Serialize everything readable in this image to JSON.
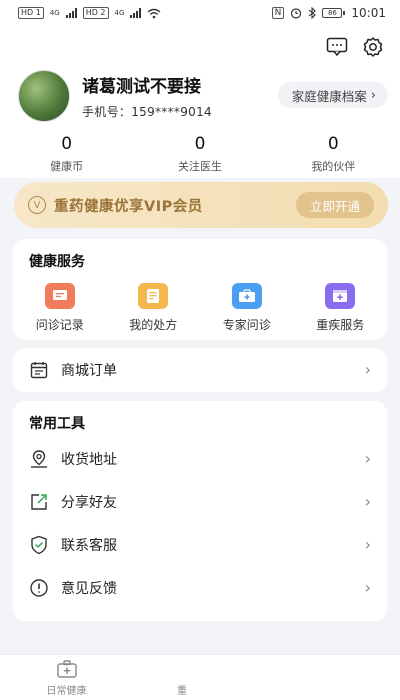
{
  "status_bar": {
    "left_chip1": "HD 1",
    "left_chip2": "HD 2",
    "sig1": "4G",
    "sig2": "4G",
    "battery": "86",
    "time": "10:01"
  },
  "header": {
    "icons": [
      "message-icon",
      "settings-icon"
    ],
    "user": {
      "name": "诸葛测试不要接",
      "phone_label": "手机号：",
      "phone": "159****9014"
    },
    "family_button": "家庭健康档案",
    "stats": [
      {
        "value": "0",
        "label": "健康币"
      },
      {
        "value": "0",
        "label": "关注医生"
      },
      {
        "value": "0",
        "label": "我的伙伴"
      }
    ]
  },
  "vip": {
    "badge": "V",
    "text": "重药健康优享VIP会员",
    "button": "立即开通"
  },
  "health_services": {
    "title": "健康服务",
    "items": [
      {
        "label": "问诊记录",
        "icon": "consult-record-icon",
        "color": "#f07c5c"
      },
      {
        "label": "我的处方",
        "icon": "prescription-icon",
        "color": "#f2b84b"
      },
      {
        "label": "专家问诊",
        "icon": "expert-consult-icon",
        "color": "#4b9ef2"
      },
      {
        "label": "重疾服务",
        "icon": "critical-illness-icon",
        "color": "#8a6cf0"
      }
    ]
  },
  "mall_order": {
    "label": "商城订单"
  },
  "tools": {
    "title": "常用工具",
    "items": [
      {
        "label": "收货地址",
        "icon": "location-icon"
      },
      {
        "label": "分享好友",
        "icon": "share-icon"
      },
      {
        "label": "联系客服",
        "icon": "shield-icon"
      },
      {
        "label": "意见反馈",
        "icon": "feedback-icon"
      }
    ]
  },
  "tabbar": {
    "tab1": "日常健康",
    "tab2": "重"
  }
}
